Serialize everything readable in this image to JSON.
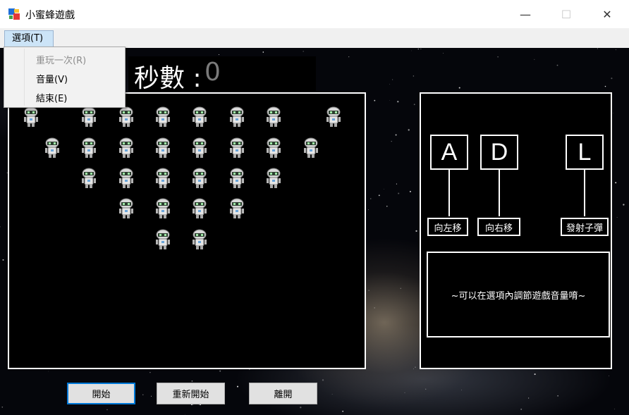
{
  "window": {
    "title": "小蜜蜂遊戲",
    "minimize": "—",
    "maximize": "☐",
    "close": "✕"
  },
  "menu": {
    "options_label": "選項(T)",
    "items": [
      {
        "label": "重玩一次(R)",
        "enabled": false
      },
      {
        "label": "音量(V)",
        "enabled": true
      },
      {
        "label": "結束(E)",
        "enabled": true
      }
    ]
  },
  "timer": {
    "label": "秒數 :",
    "value": "0"
  },
  "controls": {
    "keys": [
      {
        "key": "A",
        "action": "向左移"
      },
      {
        "key": "D",
        "action": "向右移"
      },
      {
        "key": "L",
        "action": "發射子彈"
      }
    ],
    "hint": "~可以在選項內調節遊戲音量唷~"
  },
  "buttons": {
    "start": "開始",
    "restart": "重新開始",
    "leave": "離開"
  },
  "icons": {
    "app": "app-window-icon",
    "alien": "robot-alien-icon",
    "player": "airplane-icon"
  },
  "colors": {
    "game_background": "#000000",
    "panel_border": "#ffffff",
    "timer_value": "#7a7a7a",
    "focus_border": "#0078d7"
  }
}
